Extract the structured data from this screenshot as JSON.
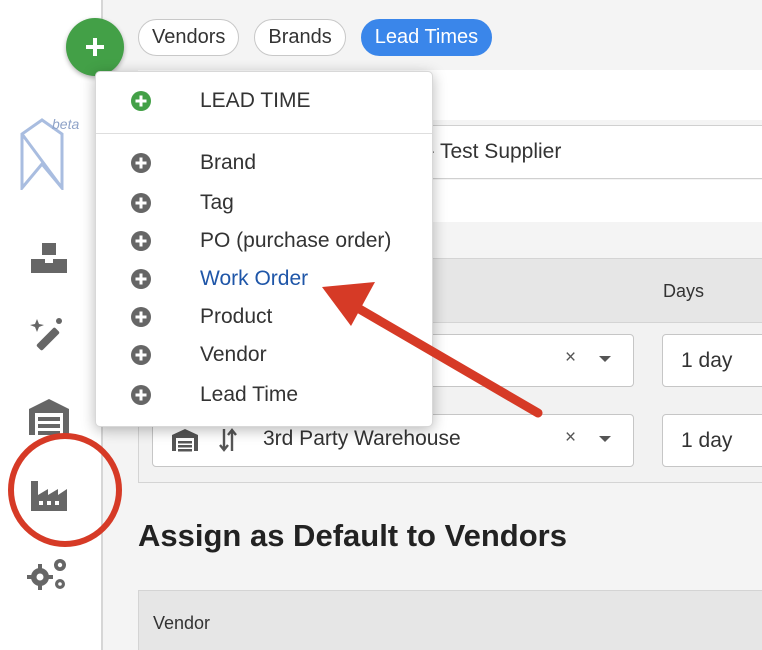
{
  "tabs": [
    {
      "label": "Vendors",
      "active": false
    },
    {
      "label": "Brands",
      "active": false
    },
    {
      "label": "Lead Times",
      "active": true
    }
  ],
  "sidebar": {
    "logo_badge": "beta",
    "items": [
      "inventory",
      "magic",
      "warehouse",
      "factory",
      "settings"
    ]
  },
  "menu": {
    "header": "LEAD TIME",
    "items": [
      {
        "label": "Brand",
        "highlighted": false
      },
      {
        "label": "Tag",
        "highlighted": false
      },
      {
        "label": "PO (purchase order)",
        "highlighted": false
      },
      {
        "label": "Work Order",
        "highlighted": true
      },
      {
        "label": "Product",
        "highlighted": false
      },
      {
        "label": "Vendor",
        "highlighted": false
      },
      {
        "label": "Lead Time",
        "highlighted": false
      }
    ]
  },
  "main": {
    "supplier_name": "e - Test Supplier",
    "days_header": "Days",
    "rows": [
      {
        "location": "",
        "days": "1 day"
      },
      {
        "location": "3rd Party Warehouse",
        "days": "1 day"
      }
    ],
    "assign_title": "Assign as Default to Vendors",
    "vendor_column": "Vendor"
  },
  "colors": {
    "accent_blue": "#3a86ea",
    "add_green": "#43a047",
    "link_blue": "#1f56a8",
    "annotation_red": "#d63a26",
    "icon_gray": "#666666"
  }
}
